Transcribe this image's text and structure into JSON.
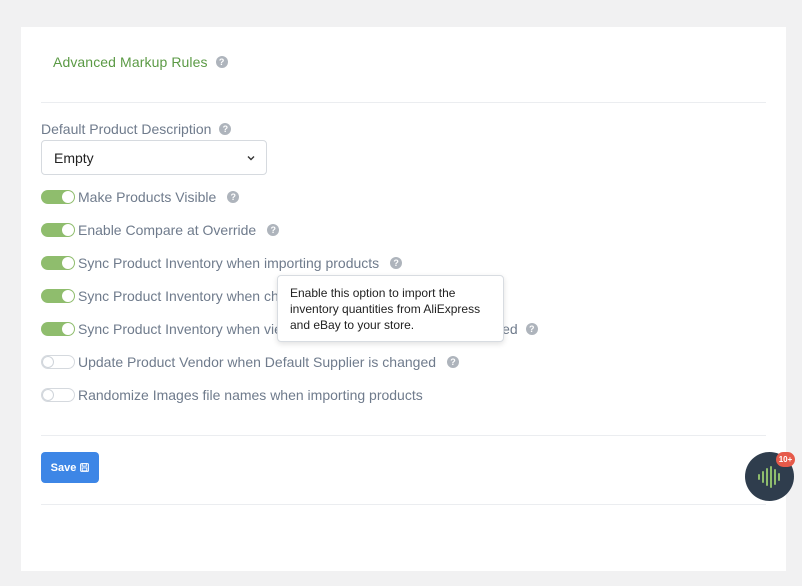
{
  "section": {
    "link_label": "Advanced Markup Rules"
  },
  "description_field": {
    "label": "Default Product Description",
    "selected": "Empty"
  },
  "toggles": [
    {
      "label": "Make Products Visible",
      "on": true,
      "help": true
    },
    {
      "label": "Enable Compare at Override",
      "on": true,
      "help": true
    },
    {
      "label": "Sync Product Inventory when importing products",
      "on": true,
      "help": true
    },
    {
      "label": "Sync Product Inventory when ch",
      "on": true,
      "help": false
    },
    {
      "label": "Sync Product Inventory when vie",
      "tail": "ied",
      "on": true,
      "help": true
    },
    {
      "label": "Update Product Vendor when Default Supplier is changed",
      "on": false,
      "help": true
    },
    {
      "label": "Randomize Images file names when importing products",
      "on": false,
      "help": false
    }
  ],
  "tooltip": {
    "text": "Enable this option to import the inventory quantities from AliExpress and eBay to your store."
  },
  "save_button": {
    "label": "Save"
  },
  "chat_widget": {
    "badge": "10+"
  },
  "icons": {
    "help": "question-circle-icon",
    "save": "floppy-disk-icon",
    "chevron": "chevron-down-icon",
    "widget": "sound-wave-icon"
  },
  "colors": {
    "accent_green": "#5b9a45",
    "toggle_on": "#8fbd6d",
    "button_blue": "#3d86e6",
    "badge_red": "#e65a4a",
    "widget_dark": "#2f3d4d"
  }
}
